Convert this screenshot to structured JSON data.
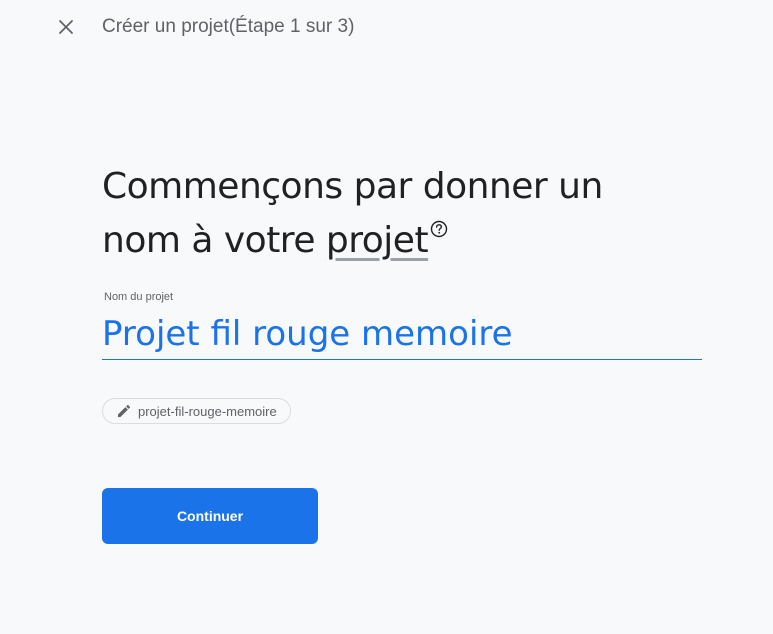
{
  "header": {
    "close_icon": "close-icon",
    "step_title": "Créer un projet(Étape 1 sur 3)"
  },
  "main": {
    "heading_part1": "Commençons par donner un nom à votre ",
    "heading_link": "projet",
    "help_icon": "help-circle-icon",
    "project_name": {
      "label": "Nom du projet",
      "value": "Projet fil rouge memoire"
    },
    "project_id": {
      "icon": "pencil-icon",
      "value": "projet-fil-rouge-memoire"
    },
    "continue_label": "Continuer"
  },
  "colors": {
    "accent": "#1a73e8",
    "background": "#f8f9fa",
    "text_primary": "#202124",
    "text_secondary": "#5f6368"
  }
}
